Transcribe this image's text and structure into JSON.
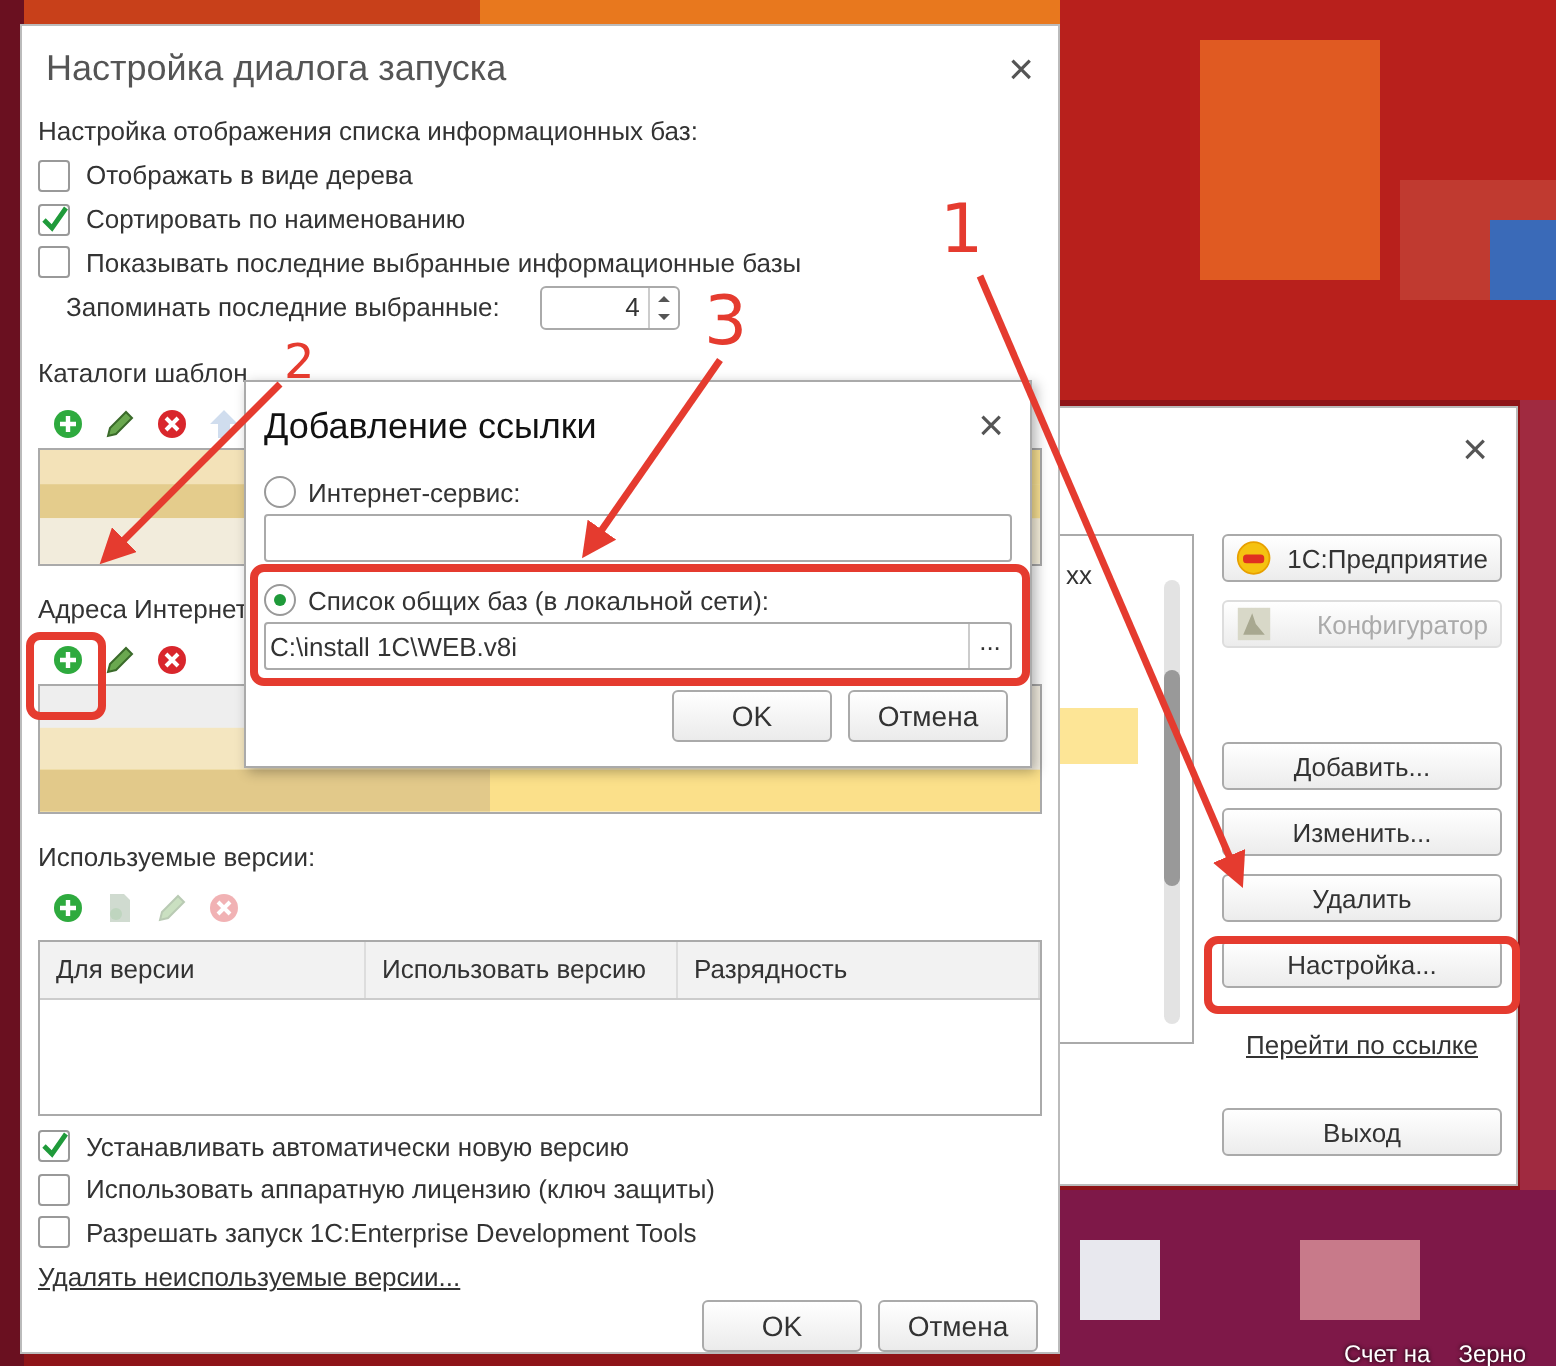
{
  "desktop": {
    "labels": [
      "Счет на",
      "Зерно"
    ]
  },
  "launcher": {
    "close": "×",
    "list_fragment": "xx",
    "buttons": [
      {
        "label": "1С:Предприятие",
        "kind": "app",
        "disabled": false
      },
      {
        "label": "Конфигуратор",
        "kind": "config",
        "disabled": true
      },
      {
        "label": "Добавить...",
        "kind": "plain",
        "disabled": false
      },
      {
        "label": "Изменить...",
        "kind": "plain",
        "disabled": false
      },
      {
        "label": "Удалить",
        "kind": "plain",
        "disabled": false
      },
      {
        "label": "Настройка...",
        "kind": "plain",
        "disabled": false
      }
    ],
    "link": "Перейти по ссылке",
    "exit": "Выход"
  },
  "settings": {
    "title": "Настройка диалога запуска",
    "close": "×",
    "display_heading": "Настройка отображения списка информационных баз:",
    "display_options": [
      {
        "label": "Отображать в виде дерева",
        "checked": false
      },
      {
        "label": "Сортировать по наименованию",
        "checked": true
      },
      {
        "label": "Показывать последние выбранные информационные базы",
        "checked": false
      }
    ],
    "remember": {
      "label": "Запоминать последние выбранные:",
      "value": "4"
    },
    "templates_heading": "Каталоги шаблон",
    "templates_tools": [
      {
        "kind": "add",
        "disabled": false
      },
      {
        "kind": "edit",
        "disabled": false
      },
      {
        "kind": "delete",
        "disabled": false
      },
      {
        "kind": "up",
        "disabled": true
      }
    ],
    "internet_heading": "Адреса Интернет",
    "internet_tools": [
      {
        "kind": "add",
        "disabled": false
      },
      {
        "kind": "edit",
        "disabled": false
      },
      {
        "kind": "delete",
        "disabled": false
      }
    ],
    "versions_heading": "Используемые версии:",
    "versions_tools": [
      {
        "kind": "add",
        "disabled": false
      },
      {
        "kind": "copy",
        "disabled": true
      },
      {
        "kind": "edit",
        "disabled": true
      },
      {
        "kind": "delete",
        "disabled": true
      }
    ],
    "versions_table": {
      "columns": [
        "Для версии",
        "Использовать версию",
        "Разрядность"
      ]
    },
    "options": [
      {
        "label": "Устанавливать автоматически новую версию",
        "checked": true
      },
      {
        "label": "Использовать аппаратную лицензию (ключ защиты)",
        "checked": false
      },
      {
        "label": "Разрешать запуск 1C:Enterprise Development Tools",
        "checked": false
      }
    ],
    "cleanup_link": "Удалять неиспользуемые версии...",
    "buttons": [
      "OK",
      "Отмена"
    ]
  },
  "add_link": {
    "title": "Добавление ссылки",
    "close": "×",
    "sources": [
      {
        "label": "Интернет-сервис:",
        "selected": false
      },
      {
        "label": "Список общих баз (в локальной сети):",
        "selected": true,
        "value": "C:\\install 1C\\WEB.v8i",
        "browse": "..."
      }
    ],
    "buttons": [
      "OK",
      "Отмена"
    ]
  },
  "annotations": [
    "1",
    "2",
    "3"
  ]
}
